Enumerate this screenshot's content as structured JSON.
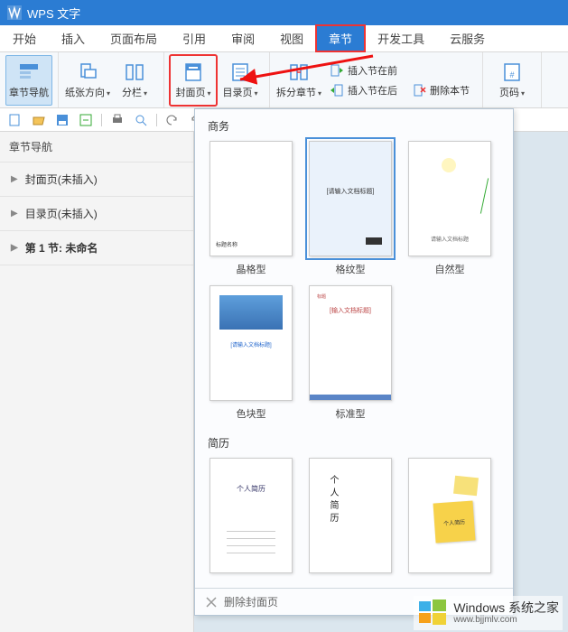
{
  "app": {
    "title": "WPS 文字"
  },
  "tabs": {
    "items": [
      {
        "label": "开始"
      },
      {
        "label": "插入"
      },
      {
        "label": "页面布局"
      },
      {
        "label": "引用"
      },
      {
        "label": "审阅"
      },
      {
        "label": "视图"
      },
      {
        "label": "章节"
      },
      {
        "label": "开发工具"
      },
      {
        "label": "云服务"
      }
    ],
    "active_index": 6
  },
  "ribbon": {
    "chapter_nav": "章节导航",
    "paper_orientation": "纸张方向",
    "columns": "分栏",
    "cover_page": "封面页",
    "toc_page": "目录页",
    "split_chapter": "拆分章节",
    "insert_before": "插入节在前",
    "insert_after": "插入节在后",
    "delete_section": "删除本节",
    "page_number": "页码"
  },
  "sidebar": {
    "title": "章节导航",
    "items": [
      {
        "label": "封面页(未插入)"
      },
      {
        "label": "目录页(未插入)"
      },
      {
        "label": "第 1 节: 未命名"
      }
    ]
  },
  "gallery": {
    "section1_title": "商务",
    "section2_title": "简历",
    "items1": [
      {
        "label": "晶格型",
        "thumb_text": ""
      },
      {
        "label": "格纹型",
        "thumb_text": "[请输入文档标题]"
      },
      {
        "label": "自然型",
        "thumb_text": "请输入文档标题"
      },
      {
        "label": "色块型",
        "thumb_text": "[请输入文档标题]"
      },
      {
        "label": "标准型",
        "thumb_text": "[输入文档标题]"
      }
    ],
    "items2": [
      {
        "label": "",
        "thumb_text": "个人简历"
      },
      {
        "label": "",
        "thumb_text": "个人简历"
      },
      {
        "label": "",
        "thumb_text": "个人简历"
      }
    ],
    "footer_label": "删除封面页"
  },
  "watermark": {
    "brand": "Windows",
    "chinese": "系统之家",
    "url": "www.bjjmlv.com"
  }
}
